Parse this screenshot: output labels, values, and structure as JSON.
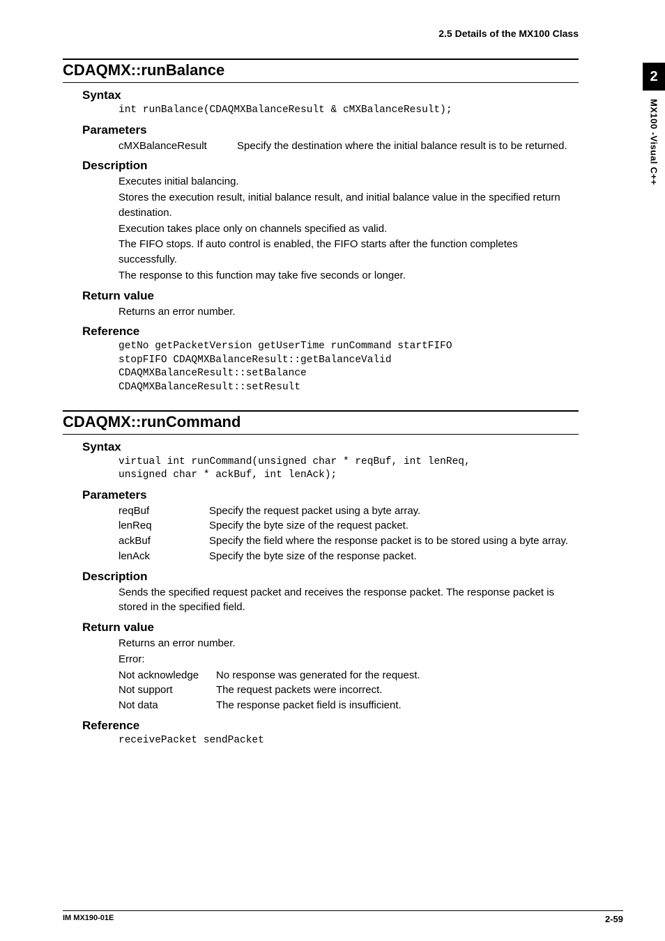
{
  "header": {
    "section_label": "2.5  Details of the MX100 Class"
  },
  "sidetab": {
    "chapter_num": "2",
    "chapter_label": "MX100 -Visual C++"
  },
  "sec1": {
    "title": "CDAQMX::runBalance",
    "syntax_h": "Syntax",
    "syntax_code": "int runBalance(CDAQMXBalanceResult & cMXBalanceResult);",
    "params_h": "Parameters",
    "params": [
      {
        "name": "cMXBalanceResult",
        "desc": "Specify the destination where the initial balance result is to be returned."
      }
    ],
    "desc_h": "Description",
    "desc_lines": [
      "Executes initial balancing.",
      "Stores the execution result, initial balance result, and initial balance value in the specified return destination.",
      "Execution takes place only on channels specified as valid.",
      "The FIFO stops. If auto control is enabled, the FIFO starts after the function completes successfully.",
      "The response to this function may take five seconds or longer."
    ],
    "return_h": "Return value",
    "return_text": "Returns an error number.",
    "ref_h": "Reference",
    "ref_code": "getNo getPacketVersion getUserTime runCommand startFIFO\nstopFIFO CDAQMXBalanceResult::getBalanceValid\nCDAQMXBalanceResult::setBalance\nCDAQMXBalanceResult::setResult"
  },
  "sec2": {
    "title": "CDAQMX::runCommand",
    "syntax_h": "Syntax",
    "syntax_code": "virtual int runCommand(unsigned char * reqBuf, int lenReq,\nunsigned char * ackBuf, int lenAck);",
    "params_h": "Parameters",
    "params": [
      {
        "name": "reqBuf",
        "desc": "Specify the request packet using a byte array."
      },
      {
        "name": "lenReq",
        "desc": "Specify the byte size of the request packet."
      },
      {
        "name": "ackBuf",
        "desc": "Specify the field where the response packet is to be stored using a byte array."
      },
      {
        "name": "lenAck",
        "desc": "Specify the byte size of the response packet."
      }
    ],
    "desc_h": "Description",
    "desc_lines": [
      "Sends the specified request packet and receives the response packet. The response packet is stored in the specified field."
    ],
    "return_h": "Return value",
    "return_text": "Returns an error number.",
    "error_label": "Error:",
    "errors": [
      {
        "name": "Not acknowledge",
        "desc": "No response was generated for the request."
      },
      {
        "name": "Not support",
        "desc": "The request packets were incorrect."
      },
      {
        "name": "Not data",
        "desc": "The response packet field is insufficient."
      }
    ],
    "ref_h": "Reference",
    "ref_code": "receivePacket sendPacket"
  },
  "footer": {
    "left": "IM MX190-01E",
    "right": "2-59"
  }
}
